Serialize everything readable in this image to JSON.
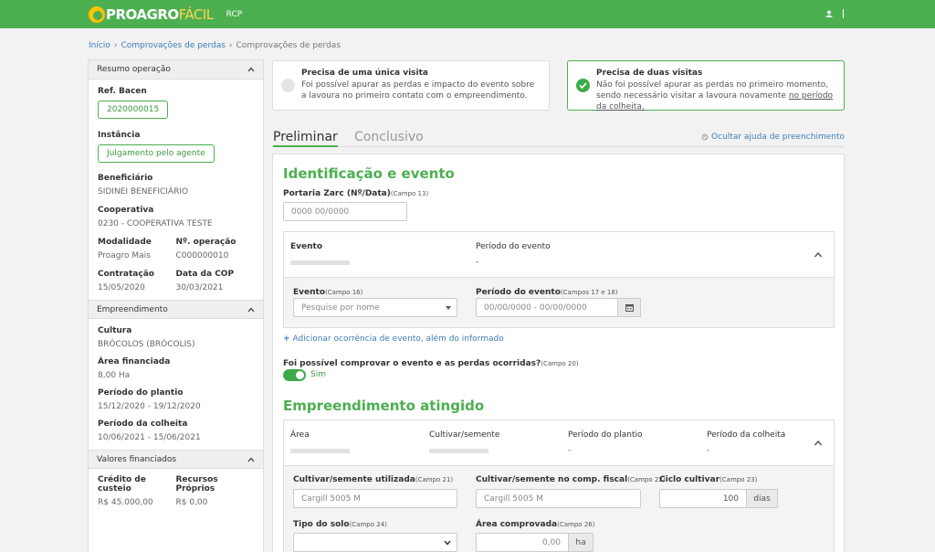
{
  "header": {
    "logo_main": "PROAGRO",
    "logo_accent": "FÁCIL",
    "module": "RCP"
  },
  "breadcrumb": {
    "home": "Início",
    "link": "Comprovações de perdas",
    "current": "Comprovações de perdas",
    "sep": "›"
  },
  "sidebar": {
    "resumo": {
      "title": "Resumo operação",
      "ref_label": "Ref. Bacen",
      "ref_value": "2020000015",
      "inst_label": "Instância",
      "inst_value": "Julgamento pelo agente",
      "benef_label": "Beneficiário",
      "benef_value": "SIDINEI BENEFICIÁRIO",
      "coop_label": "Cooperativa",
      "coop_value": "0230 - COOPERATIVA TESTE",
      "mod_label": "Modalidade",
      "mod_value": "Proagro Mais",
      "nop_label": "Nº. operação",
      "nop_value": "C000000010",
      "contr_label": "Contratação",
      "contr_value": "15/05/2020",
      "dcop_label": "Data da COP",
      "dcop_value": "30/03/2021"
    },
    "empreendimento": {
      "title": "Empreendimento",
      "cultura_label": "Cultura",
      "cultura_value": "BRÓCOLOS (BRÓCOLIS)",
      "area_label": "Área financiada",
      "area_value": "8,00 Ha",
      "plantio_label": "Período do plantio",
      "plantio_value": "15/12/2020 - 19/12/2020",
      "colheita_label": "Período da colheita",
      "colheita_value": "10/06/2021 - 15/06/2021"
    },
    "valores": {
      "title": "Valores financiados",
      "credito_label": "Crédito de custeio",
      "credito_value": "R$ 45.000,00",
      "recursos_label": "Recursos Próprios",
      "recursos_value": "R$ 0,00"
    }
  },
  "cards": [
    {
      "title": "Precisa de uma única visita",
      "desc": "Foi possível apurar as perdas e impacto do evento sobre a lavoura no primeiro contato com o empreendimento.",
      "desc_link": ""
    },
    {
      "title": "Precisa de duas visitas",
      "desc": "Não foi possível apurar as perdas no primeiro momento, sendo necessário visitar a lavoura novamente ",
      "desc_link": "no período da colheita."
    }
  ],
  "tabs": {
    "t1": "Preliminar",
    "t2": "Conclusivo",
    "help": "Ocultar ajuda de preenchimento"
  },
  "form": {
    "sec1": "Identificação e evento",
    "portaria_label": "Portaria Zarc (Nº/Data)",
    "portaria_campo": "(Campo 13)",
    "portaria_ph": "0000 00/0000",
    "evento_head": "Evento",
    "periodo_head": "Período do evento",
    "periodo_head_val": "-",
    "evento_label": "Evento",
    "evento_campo": "(Campo 16)",
    "evento_ph": "Pesquise por nome",
    "pevento_label": "Período do evento",
    "pevento_campo": "(Campos 17 e 18)",
    "pevento_ph": "00/00/0000 - 00/00/0000",
    "add_link": "Adicionar ocorrência de evento, além do informado",
    "comprovar_label": "Foi possível comprovar o evento e as perdas ocorridas?",
    "comprovar_campo": "(Campo 20)",
    "comprovar_value": "Sim",
    "sec2": "Empreendimento atingido",
    "h_area": "Área",
    "h_cultivar": "Cultivar/semente",
    "h_plantio": "Período do plantio",
    "h_plantio_val": "-",
    "h_colheita": "Período da colheita",
    "h_colheita_val": "-",
    "cult_label": "Cultivar/semente utilizada",
    "cult_campo": "(Campo 21)",
    "cult_ph": "Cargill 5005 M",
    "cultf_label": "Cultivar/semente no comp. fiscal",
    "cultf_campo": "(Campo 22)",
    "cultf_ph": "Cargill 5005 M",
    "ciclo_label": "Ciclo cultivar",
    "ciclo_campo": "(Campo 23)",
    "ciclo_value": "100",
    "ciclo_unit": "dias",
    "solo_label": "Tipo do solo",
    "solo_campo": "(Campo 24)",
    "areac_label": "Área comprovada",
    "areac_campo": "(Campo 26)",
    "areac_value": "0,00",
    "areac_unit": "ha"
  },
  "colors": {
    "brand": "#4caf50",
    "link": "#3f7db8"
  }
}
